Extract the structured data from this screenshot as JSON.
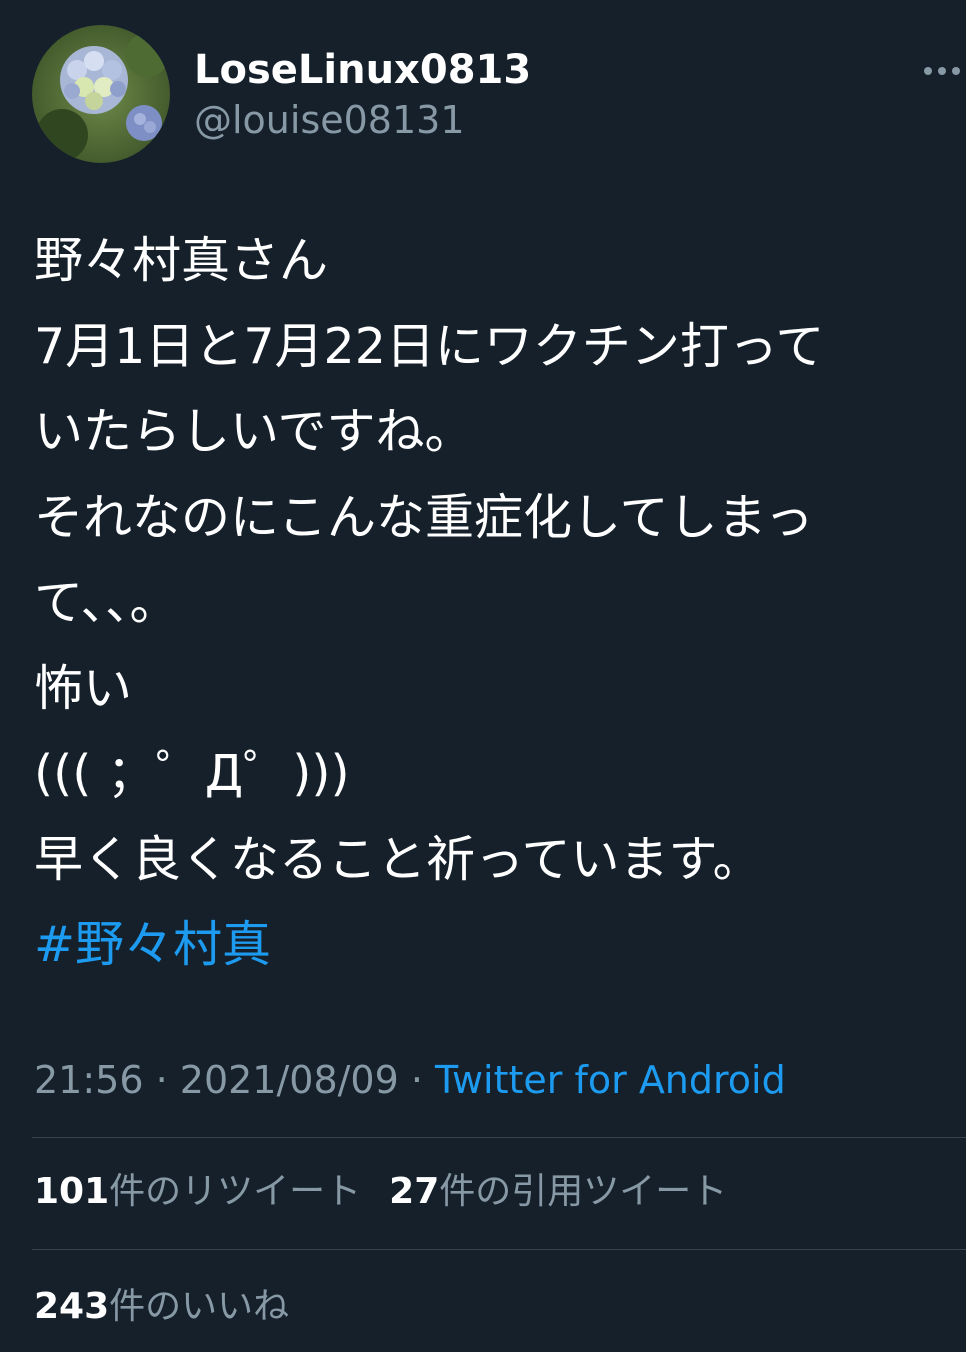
{
  "user": {
    "display_name": "LoseLinux0813",
    "handle": "@louise08131",
    "avatar_icon": "hydrangea-flower-photo"
  },
  "tweet": {
    "lines": [
      "野々村真さん",
      "7月1日と7月22日にワクチン打って",
      "いたらしいですね。",
      "それなのにこんな重症化してしまっ",
      "て、、。",
      "怖い",
      "((( ；゜Д゜)))",
      "早く良くなること祈っています。"
    ],
    "hashtag": "#野々村真"
  },
  "meta": {
    "time": "21:56",
    "separator": " · ",
    "date": "2021/08/09",
    "source": "Twitter for Android"
  },
  "stats": {
    "retweets_count": "101",
    "retweets_label": "件のリツイート",
    "quotes_count": "27",
    "quotes_label": "件の引用ツイート",
    "likes_count": "243",
    "likes_label": "件のいいね"
  },
  "colors": {
    "background": "#15202b",
    "text": "#ffffff",
    "secondary": "#8899a6",
    "accent": "#1d9bf0",
    "divider": "#38444d"
  },
  "icons": [
    "more-horizontal-icon"
  ]
}
